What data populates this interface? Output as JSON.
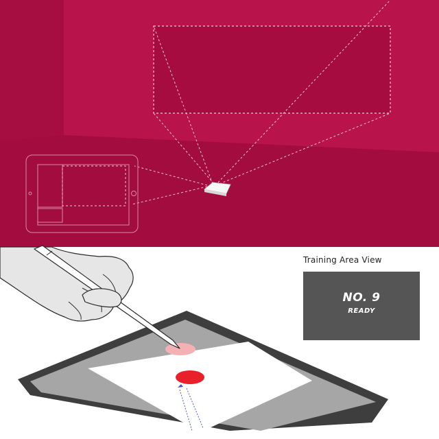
{
  "training_view": {
    "title": "Training Area View",
    "number_label": "NO. 9",
    "status_label": "READY"
  },
  "colors": {
    "room_wall_back": "#B8134A",
    "room_wall_left": "#A60E41",
    "room_floor": "#A20C3F",
    "panel_bg": "#555555",
    "target_red": "#E8202A",
    "target_pink": "#F4B1B3",
    "guide_blue": "#4A56C8"
  }
}
